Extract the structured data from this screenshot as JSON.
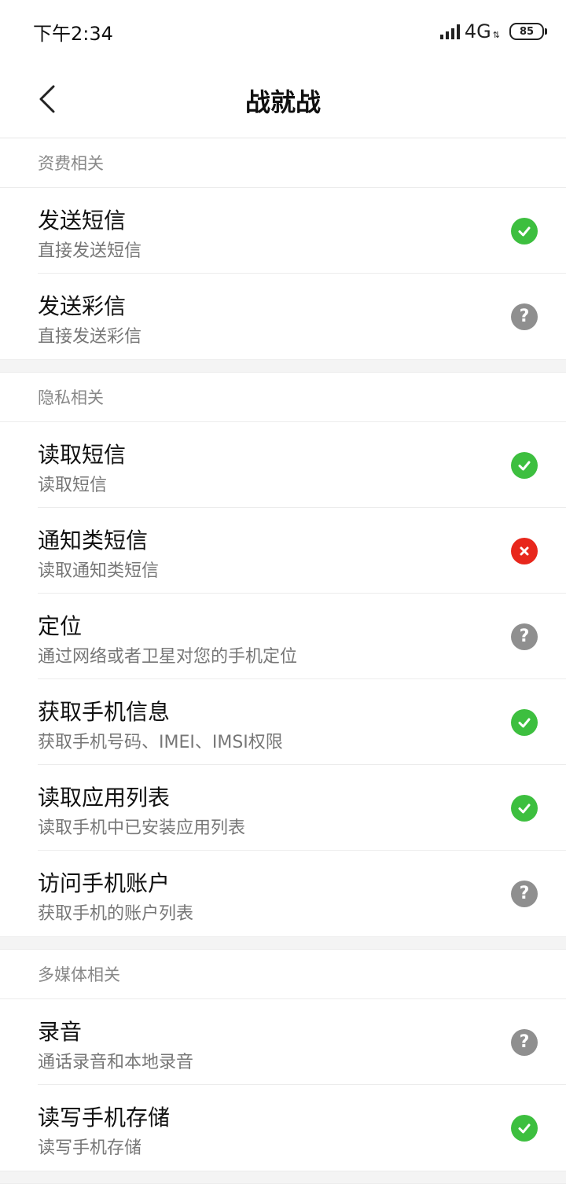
{
  "status_bar": {
    "time": "下午2:34",
    "network": "4G",
    "battery": "85"
  },
  "header": {
    "title": "战就战",
    "back_icon": "chevron-left-icon"
  },
  "colors": {
    "allowed": "#3dbf3f",
    "denied": "#e8271c",
    "ask": "#8f8f8f"
  },
  "sections": [
    {
      "title": "资费相关",
      "items": [
        {
          "title": "发送短信",
          "subtitle": "直接发送短信",
          "status": "allowed"
        },
        {
          "title": "发送彩信",
          "subtitle": "直接发送彩信",
          "status": "ask"
        }
      ]
    },
    {
      "title": "隐私相关",
      "items": [
        {
          "title": "读取短信",
          "subtitle": "读取短信",
          "status": "allowed"
        },
        {
          "title": "通知类短信",
          "subtitle": "读取通知类短信",
          "status": "denied"
        },
        {
          "title": "定位",
          "subtitle": "通过网络或者卫星对您的手机定位",
          "status": "ask"
        },
        {
          "title": "获取手机信息",
          "subtitle": "获取手机号码、IMEI、IMSI权限",
          "status": "allowed"
        },
        {
          "title": "读取应用列表",
          "subtitle": "读取手机中已安装应用列表",
          "status": "allowed"
        },
        {
          "title": "访问手机账户",
          "subtitle": "获取手机的账户列表",
          "status": "ask"
        }
      ]
    },
    {
      "title": "多媒体相关",
      "items": [
        {
          "title": "录音",
          "subtitle": "通话录音和本地录音",
          "status": "ask"
        },
        {
          "title": "读写手机存储",
          "subtitle": "读写手机存储",
          "status": "allowed"
        }
      ]
    }
  ]
}
